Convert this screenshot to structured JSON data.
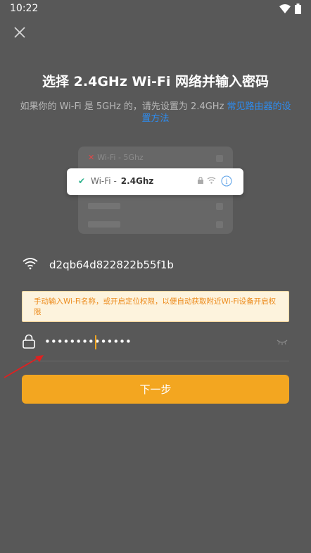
{
  "status_bar": {
    "time": "10:22"
  },
  "header": {
    "title": "选择 2.4GHz Wi-Fi 网络并输入密码",
    "subtitle_prefix": "如果你的 Wi-Fi 是 5GHz 的，请先设置为 2.4GHz ",
    "subtitle_link": "常见路由器的设置方法"
  },
  "illustration": {
    "row_5ghz_label": "Wi-Fi - 5Ghz",
    "row_24ghz_prefix": "Wi-Fi -",
    "row_24ghz_band": "2.4Ghz"
  },
  "wifi": {
    "ssid": "d2qb64d822822b55f1b"
  },
  "notice": {
    "text": "手动输入Wi-Fi名称，或开启定位权限，以便自动获取附近Wi-Fi设备开启权限"
  },
  "password": {
    "value": "••••••••••••••"
  },
  "actions": {
    "next_label": "下一步"
  },
  "colors": {
    "accent": "#f3a620",
    "link": "#2d8cf0",
    "notice_text": "#ec8a1a",
    "background": "#585858"
  },
  "icons": [
    "wifi-icon",
    "battery-icon",
    "close-icon",
    "lock-icon",
    "eye-closed-icon",
    "info-icon",
    "arrow-annotation"
  ]
}
